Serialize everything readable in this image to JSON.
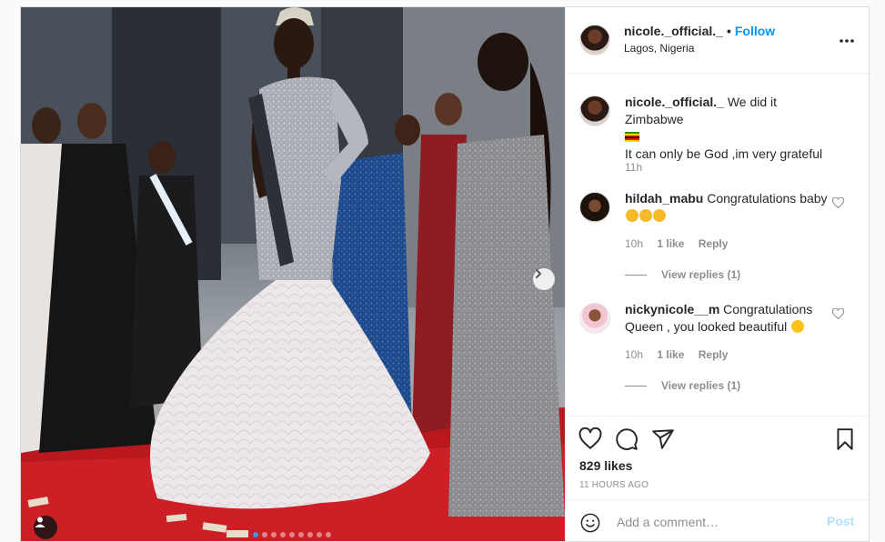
{
  "post": {
    "author": {
      "username": "nicole._official._",
      "follow_label": "Follow",
      "location": "Lagos, Nigeria"
    },
    "image": {
      "description": "Pageant contestant wearing a crown, sash and silver sequined gown with white feather skirt on a red carpet stage",
      "slide_count": 9,
      "active_slide": 1
    },
    "caption": {
      "username": "nicole._official._",
      "line1": "We did it Zimbabwe",
      "line2": "It can only be God ,im very grateful",
      "time": "11h"
    },
    "comments": [
      {
        "username": "hildah_mabu",
        "text": "Congratulations baby",
        "emoji": "clapping-hands x3",
        "time": "10h",
        "likes": "1 like",
        "reply_label": "Reply",
        "view_replies": "View replies (1)"
      },
      {
        "username": "nickynicole__m",
        "text": "Congratulations Queen , you looked beautiful",
        "emoji": "heart-eyes",
        "time": "10h",
        "likes": "1 like",
        "reply_label": "Reply",
        "view_replies": "View replies (1)"
      }
    ],
    "likes": "829 likes",
    "timestamp": "11 HOURS AGO",
    "add_comment": {
      "placeholder": "Add a comment…",
      "post_label": "Post"
    }
  },
  "colors": {
    "link_blue": "#0095f6",
    "post_disabled": "#b2dffc",
    "muted": "#8e8e8e",
    "border": "#dbdbdb"
  },
  "icons": [
    "more-options-icon",
    "heart-icon",
    "comment-icon",
    "share-icon",
    "bookmark-icon",
    "emoji-icon",
    "chevron-right-icon",
    "user-tag-icon"
  ]
}
